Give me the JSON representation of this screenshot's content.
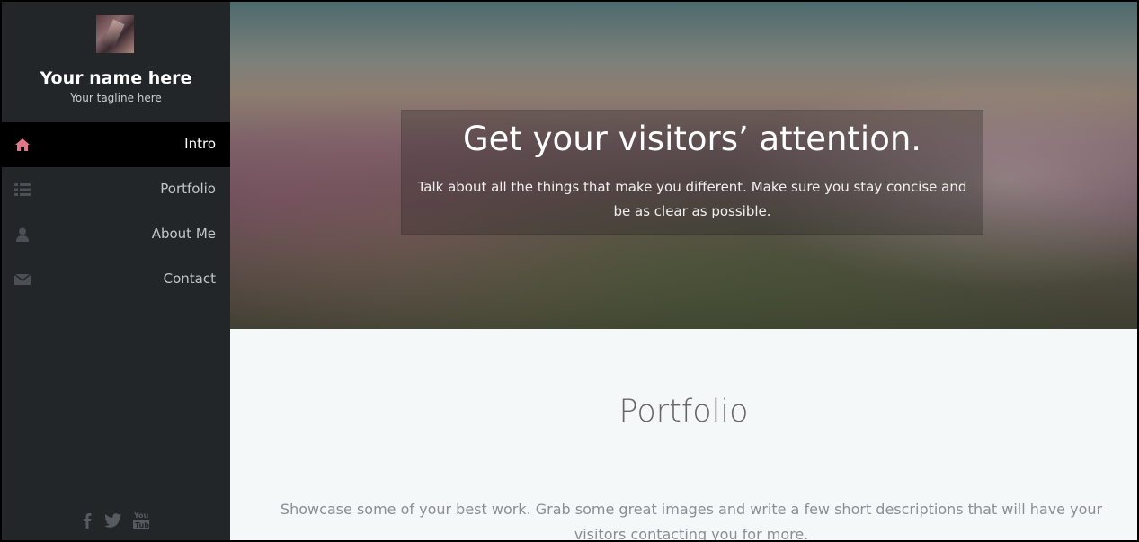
{
  "sidebar": {
    "name": "Your name here",
    "tagline": "Your tagline here",
    "items": [
      {
        "label": "Intro",
        "icon": "home-icon",
        "active": true
      },
      {
        "label": "Portfolio",
        "icon": "list-icon",
        "active": false
      },
      {
        "label": "About Me",
        "icon": "user-icon",
        "active": false
      },
      {
        "label": "Contact",
        "icon": "envelope-icon",
        "active": false
      }
    ],
    "social": [
      "facebook-icon",
      "twitter-icon",
      "youtube-icon"
    ]
  },
  "hero": {
    "title": "Get your visitors’ attention.",
    "text": "Talk about all the things that make you different. Make sure you stay concise and be as clear as possible."
  },
  "portfolio": {
    "title": "Portfolio",
    "text": "Showcase some of your best work. Grab some great images and write a few short descriptions that will have your visitors contacting you for more."
  },
  "colors": {
    "sidebar_bg": "#222629",
    "active_bg": "#000000",
    "accent": "#e27689",
    "section_bg": "#f5f8f9"
  }
}
